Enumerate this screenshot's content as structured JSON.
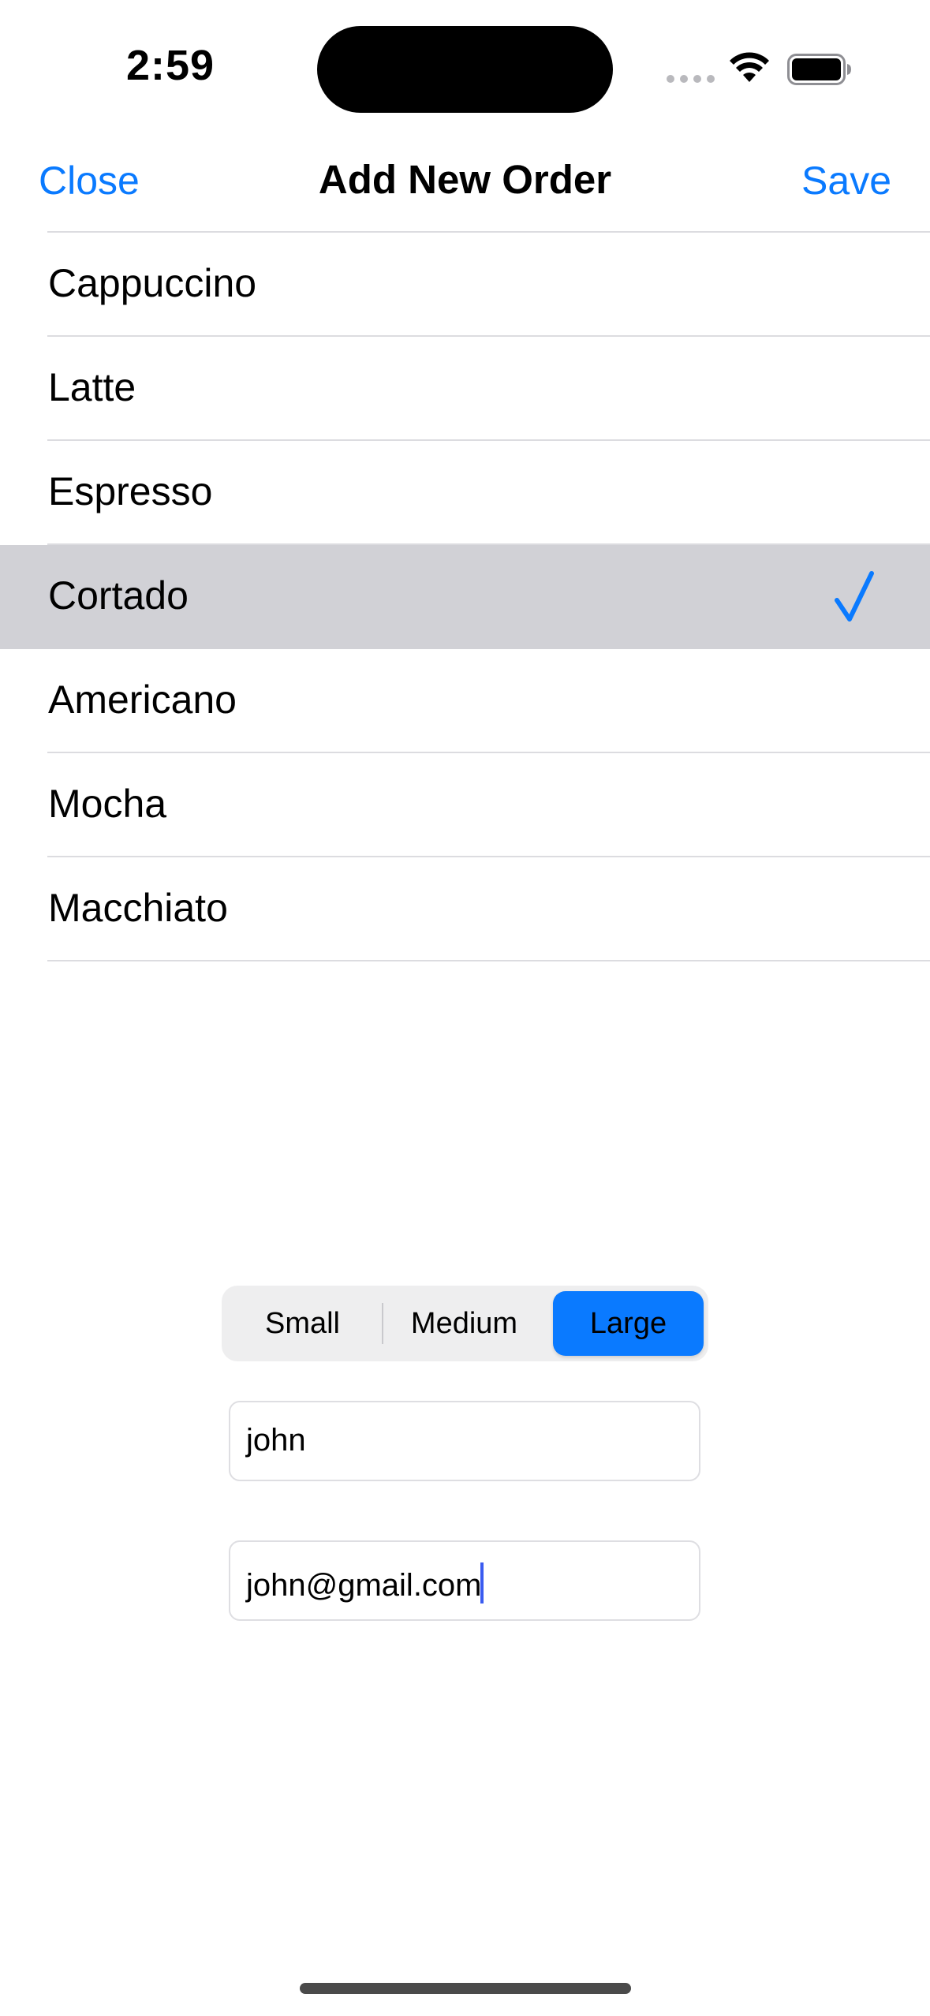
{
  "status_bar": {
    "time": "2:59"
  },
  "nav": {
    "close_label": "Close",
    "title": "Add New Order",
    "save_label": "Save"
  },
  "coffee_list": {
    "items": [
      {
        "label": "Cappuccino",
        "selected": false
      },
      {
        "label": "Latte",
        "selected": false
      },
      {
        "label": "Espresso",
        "selected": false
      },
      {
        "label": "Cortado",
        "selected": true
      },
      {
        "label": "Americano",
        "selected": false
      },
      {
        "label": "Mocha",
        "selected": false
      },
      {
        "label": "Macchiato",
        "selected": false
      }
    ],
    "check_icon": "checkmark-icon"
  },
  "size_picker": {
    "options": [
      "Small",
      "Medium",
      "Large"
    ],
    "selected": "Large"
  },
  "form": {
    "name_value": "john",
    "email_value": "john@gmail.com"
  },
  "colors": {
    "accent": "#0a7aff",
    "selected_row": "#d1d1d6",
    "segment_bg": "#eeeeef"
  }
}
